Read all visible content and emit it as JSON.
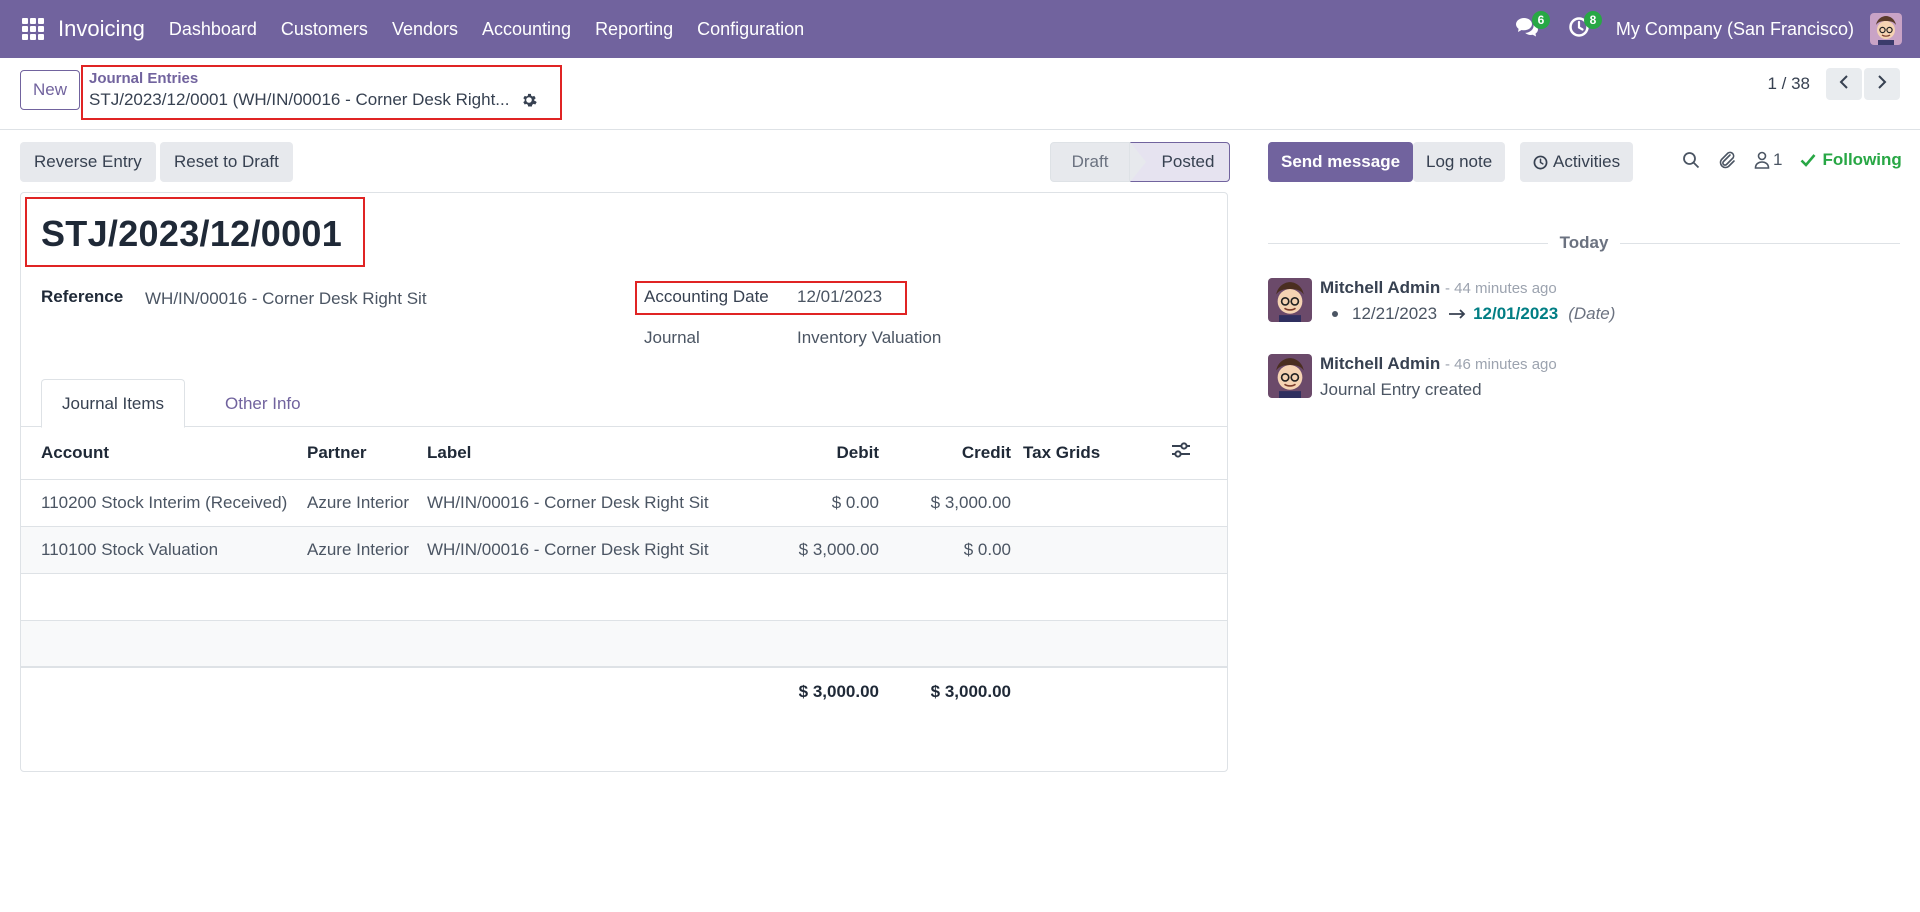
{
  "navbar": {
    "app_name": "Invoicing",
    "menu": [
      "Dashboard",
      "Customers",
      "Vendors",
      "Accounting",
      "Reporting",
      "Configuration"
    ],
    "messages_count": "6",
    "activities_count": "8",
    "company": "My Company (San Francisco)",
    "bg_color": "#71639e"
  },
  "control_panel": {
    "new_label": "New",
    "breadcrumb_parent": "Journal Entries",
    "breadcrumb_current": "STJ/2023/12/0001 (WH/IN/00016 - Corner Desk Right...",
    "pager_value": "1 / 38"
  },
  "actions": {
    "reverse_entry": "Reverse Entry",
    "reset_to_draft": "Reset to Draft"
  },
  "status": {
    "draft": "Draft",
    "posted": "Posted"
  },
  "form": {
    "title": "STJ/2023/12/0001",
    "reference_label": "Reference",
    "reference_value": "WH/IN/00016 - Corner Desk Right Sit",
    "accounting_date_label": "Accounting Date",
    "accounting_date_value": "12/01/2023",
    "journal_label": "Journal",
    "journal_value": "Inventory Valuation",
    "tabs": [
      "Journal Items",
      "Other Info"
    ]
  },
  "lines": {
    "headers": [
      "Account",
      "Partner",
      "Label",
      "Debit",
      "Credit",
      "Tax Grids"
    ],
    "rows": [
      {
        "account": "110200 Stock Interim (Received)",
        "partner": "Azure Interior",
        "label": "WH/IN/00016 - Corner Desk Right Sit",
        "debit": "$ 0.00",
        "credit": "$ 3,000.00"
      },
      {
        "account": "110100 Stock Valuation",
        "partner": "Azure Interior",
        "label": "WH/IN/00016 - Corner Desk Right Sit",
        "debit": "$ 3,000.00",
        "credit": "$ 0.00"
      }
    ],
    "total_debit": "$ 3,000.00",
    "total_credit": "$ 3,000.00"
  },
  "chatter": {
    "send_message": "Send message",
    "log_note": "Log note",
    "activities": "Activities",
    "followers_count": "1",
    "following": "Following",
    "date_separator": "Today",
    "messages": [
      {
        "author": "Mitchell Admin",
        "time": "- 44 minutes ago",
        "old_value": "12/21/2023",
        "new_value": "12/01/2023",
        "field": "(Date)"
      },
      {
        "author": "Mitchell Admin",
        "time": "- 46 minutes ago",
        "body": "Journal Entry created"
      }
    ]
  }
}
